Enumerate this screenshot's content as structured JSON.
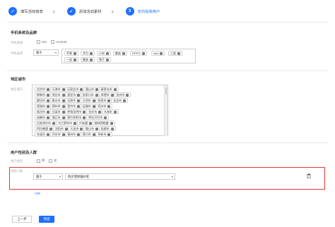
{
  "steps": [
    {
      "num": "✓",
      "label": "填写活动信息",
      "state": "done"
    },
    {
      "num": "✓",
      "label": "添加活动素材",
      "state": "done"
    },
    {
      "num": "3",
      "label": "定向投放用户",
      "state": "active"
    }
  ],
  "phone_section": {
    "title": "手机系统及品牌",
    "os_label": "手机系统",
    "os_options": [
      "iOS",
      "Android"
    ],
    "brand_label": "手机品牌",
    "brand_mode": "属于",
    "brands": [
      "苹果",
      "华为",
      "小米",
      "魅族",
      "OPPO",
      "vivo",
      "三星",
      "一加",
      "魅族",
      "锤子"
    ]
  },
  "region_section": {
    "title": "地区城市",
    "region_label": "地区城市",
    "cities": [
      [
        "北京市",
        "天津市",
        "石家庄市",
        "唐山市",
        "秦皇岛市"
      ],
      [
        "邯郸市",
        "邢台市",
        "保定市",
        "张家口市",
        "承德市",
        "沧州市"
      ],
      [
        "廊坊市",
        "衡水市",
        "太原市",
        "大同市",
        "阳泉市",
        "长治市"
      ],
      [
        "晋城市",
        "朔州市",
        "晋中市",
        "运城市",
        "忻州市"
      ],
      [
        "临汾市",
        "吕梁市",
        "呼和浩特市",
        "包头市",
        "乌海市"
      ],
      [
        "赤峰市",
        "通辽市",
        "鄂尔多斯市",
        "呼伦贝尔市"
      ],
      [
        "巴彦淖尔市",
        "乌兰察布市",
        "兴安盟",
        "锡林郭勒盟"
      ],
      [
        "阿拉善盟",
        "沈阳市",
        "大连市",
        "鞍山市",
        "抚顺市"
      ],
      [
        "本溪市",
        "丹东市",
        "锦州市",
        "营口市",
        "阜新市"
      ]
    ]
  },
  "user_section": {
    "title": "用户性别及人群",
    "gender_label": "用户性别",
    "gender_options": [
      "男",
      "女"
    ],
    "crowd_label": "目标人群",
    "crowd_mode": "属于",
    "crowd_value": "购买理财偏好者",
    "add_or": "+OR"
  },
  "footer": {
    "prev": "上一步",
    "done": "完成"
  },
  "colors": {
    "primary": "#1f6fff",
    "highlight": "#e33333"
  }
}
